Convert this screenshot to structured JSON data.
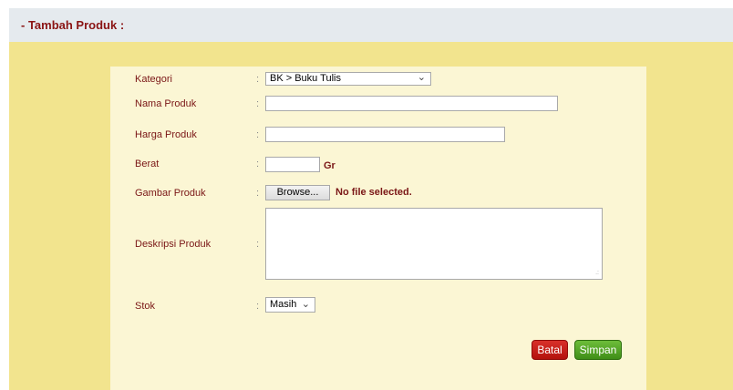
{
  "header": {
    "title": "- Tambah Produk :"
  },
  "form": {
    "colon": ":",
    "kategori": {
      "label": "Kategori",
      "selected": "BK > Buku Tulis"
    },
    "nama_produk": {
      "label": "Nama Produk",
      "value": ""
    },
    "harga_produk": {
      "label": "Harga Produk",
      "value": ""
    },
    "berat": {
      "label": "Berat",
      "value": "",
      "unit": "Gr"
    },
    "gambar_produk": {
      "label": "Gambar Produk",
      "browse_label": "Browse...",
      "file_status": "No file selected."
    },
    "deskripsi_produk": {
      "label": "Deskripsi Produk",
      "value": ""
    },
    "stok": {
      "label": "Stok",
      "selected": "Masih"
    }
  },
  "actions": {
    "cancel_label": "Batal",
    "save_label": "Simpan"
  },
  "icons": {
    "dropdown": "chevron-down-icon",
    "resize": "resize-grip-icon"
  },
  "colors": {
    "header_bg": "#e5eaee",
    "title_text": "#8a1414",
    "outer_bg": "#f2e48e",
    "panel_bg": "#fbf6d4",
    "label_text": "#7a1616",
    "cancel_button": "#c41f19",
    "save_button": "#55a629"
  }
}
